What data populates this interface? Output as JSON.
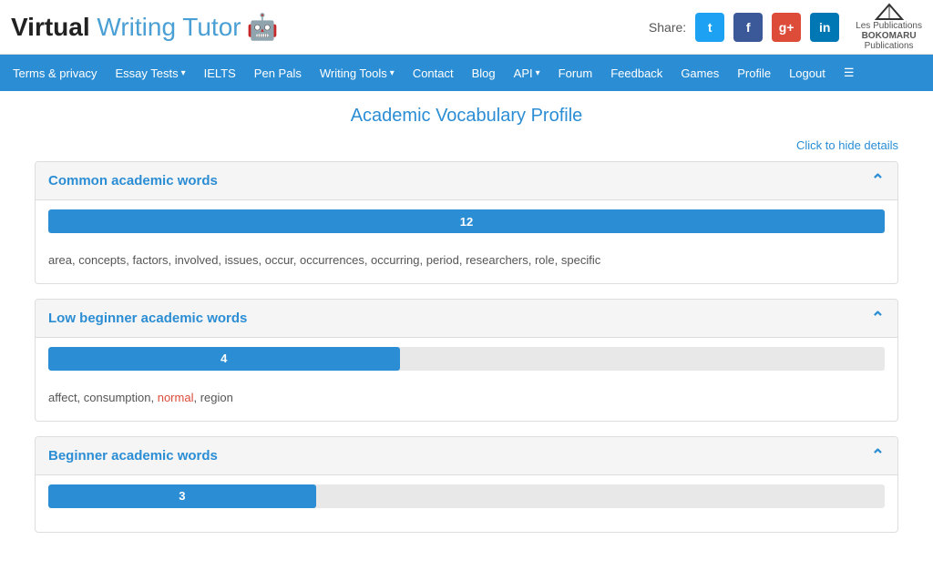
{
  "header": {
    "logo_bold": "Virtual",
    "logo_light": " Writing Tutor",
    "robot_emoji": "🤖",
    "share_label": "Share:",
    "social_buttons": [
      {
        "id": "twitter",
        "label": "t",
        "class": "social-twitter",
        "title": "Twitter"
      },
      {
        "id": "facebook",
        "label": "f",
        "class": "social-facebook",
        "title": "Facebook"
      },
      {
        "id": "google",
        "label": "g+",
        "class": "social-google",
        "title": "Google+"
      },
      {
        "id": "linkedin",
        "label": "in",
        "class": "social-linkedin",
        "title": "LinkedIn"
      }
    ],
    "bokomaru_line1": "Les Publications",
    "bokomaru_line2": "BOKOMARU",
    "bokomaru_line3": "Publications"
  },
  "navbar": {
    "items": [
      {
        "label": "Terms & privacy",
        "has_dropdown": false
      },
      {
        "label": "Essay Tests",
        "has_dropdown": true
      },
      {
        "label": "IELTS",
        "has_dropdown": false
      },
      {
        "label": "Pen Pals",
        "has_dropdown": false
      },
      {
        "label": "Writing Tools",
        "has_dropdown": true
      },
      {
        "label": "Contact",
        "has_dropdown": false
      },
      {
        "label": "Blog",
        "has_dropdown": false
      },
      {
        "label": "API",
        "has_dropdown": true
      },
      {
        "label": "Forum",
        "has_dropdown": false
      },
      {
        "label": "Feedback",
        "has_dropdown": false
      },
      {
        "label": "Games",
        "has_dropdown": false
      },
      {
        "label": "Profile",
        "has_dropdown": false
      },
      {
        "label": "Logout",
        "has_dropdown": false
      },
      {
        "label": "☰",
        "has_dropdown": false
      }
    ]
  },
  "main": {
    "page_title": "Academic Vocabulary Profile",
    "hide_details_link": "Click to hide details",
    "sections": [
      {
        "id": "common",
        "title": "Common academic words",
        "progress_value": 12,
        "progress_percent": 100,
        "words": "area, concepts, factors, involved, issues, occur, occurrences, occurring, period, researchers, role, specific",
        "highlighted_words": []
      },
      {
        "id": "low-beginner",
        "title": "Low beginner academic words",
        "progress_value": 4,
        "progress_percent": 42,
        "words_parts": [
          {
            "text": "affect, consumption, ",
            "highlight": false
          },
          {
            "text": "normal",
            "highlight": true
          },
          {
            "text": ", region",
            "highlight": false
          }
        ]
      },
      {
        "id": "beginner",
        "title": "Beginner academic words",
        "progress_value": 3,
        "progress_percent": 32,
        "words": "",
        "highlighted_words": []
      }
    ]
  }
}
